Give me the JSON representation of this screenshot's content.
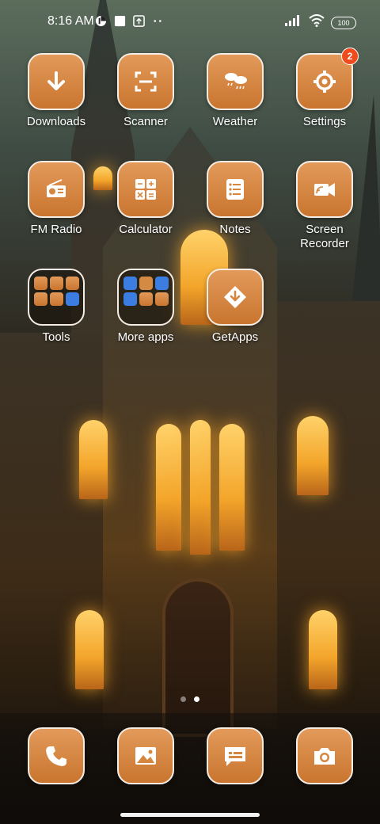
{
  "status_bar": {
    "time": "8:16 AM",
    "left_icons": [
      "data-saver-icon",
      "square-notification-icon",
      "upload-icon",
      "more-dots-icon"
    ],
    "right_icons": [
      "signal-icon",
      "wifi-icon"
    ],
    "battery": "100"
  },
  "apps": [
    {
      "label": "Downloads",
      "icon": "download-icon"
    },
    {
      "label": "Scanner",
      "icon": "scanner-icon"
    },
    {
      "label": "Weather",
      "icon": "weather-icon"
    },
    {
      "label": "Settings",
      "icon": "gear-icon",
      "badge": "2"
    },
    {
      "label": "FM Radio",
      "icon": "radio-icon"
    },
    {
      "label": "Calculator",
      "icon": "calculator-icon"
    },
    {
      "label": "Notes",
      "icon": "notes-icon"
    },
    {
      "label": "Screen\nRecorder",
      "icon": "screen-recorder-icon"
    },
    {
      "label": "Tools",
      "icon": "folder-icon"
    },
    {
      "label": "More apps",
      "icon": "folder-icon"
    },
    {
      "label": "GetApps",
      "icon": "getapps-icon"
    }
  ],
  "page_indicator": {
    "count": 2,
    "active": 2
  },
  "dock": [
    {
      "icon": "phone-icon"
    },
    {
      "icon": "gallery-icon"
    },
    {
      "icon": "messages-icon"
    },
    {
      "icon": "camera-icon"
    }
  ],
  "colors": {
    "icon_bg": "#d88a46",
    "icon_border": "#f5ede4",
    "badge": "#f04b1c"
  }
}
